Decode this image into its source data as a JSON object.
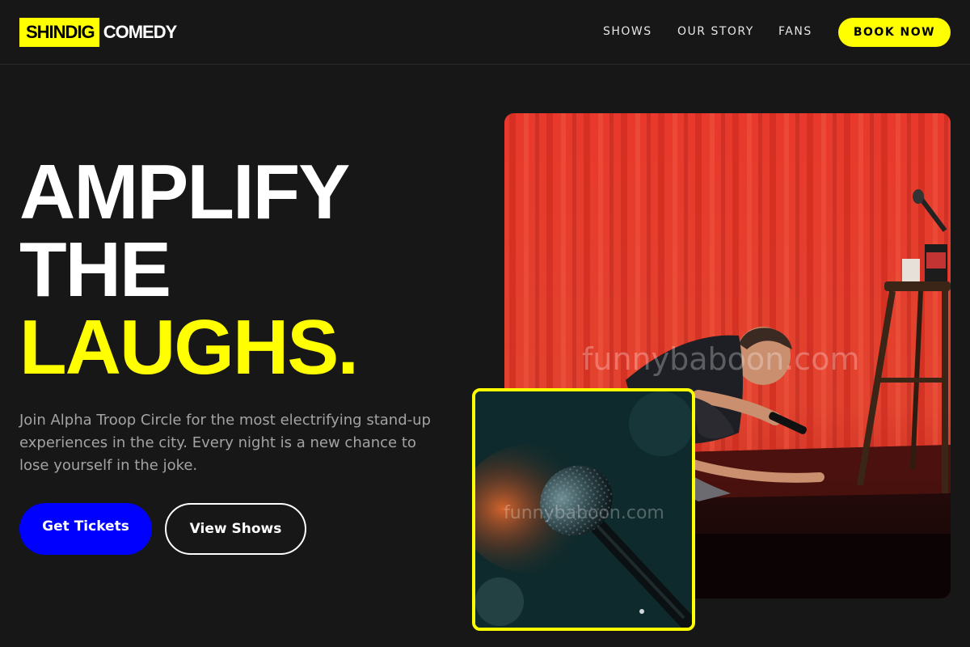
{
  "brand": {
    "logo_highlight": "SHINDIG",
    "logo_text": "COMEDY",
    "accent_color": "#ffff00",
    "primary_color": "#0000ff"
  },
  "nav": {
    "items": [
      {
        "label": "SHOWS"
      },
      {
        "label": "OUR STORY"
      },
      {
        "label": "FANS"
      }
    ],
    "cta_label": "BOOK NOW"
  },
  "hero": {
    "headline_line1": "AMPLIFY",
    "headline_line2": "THE",
    "headline_line3": "LAUGHS.",
    "description": "Join Alpha Troop Circle for the most electrifying stand-up experiences in the city. Every night is a new chance to lose yourself in the joke.",
    "primary_button": "Get Tickets",
    "secondary_button": "View Shows"
  },
  "images": {
    "main_watermark": "funnybaboon.com",
    "inset_watermark": "funnybaboon.com"
  }
}
